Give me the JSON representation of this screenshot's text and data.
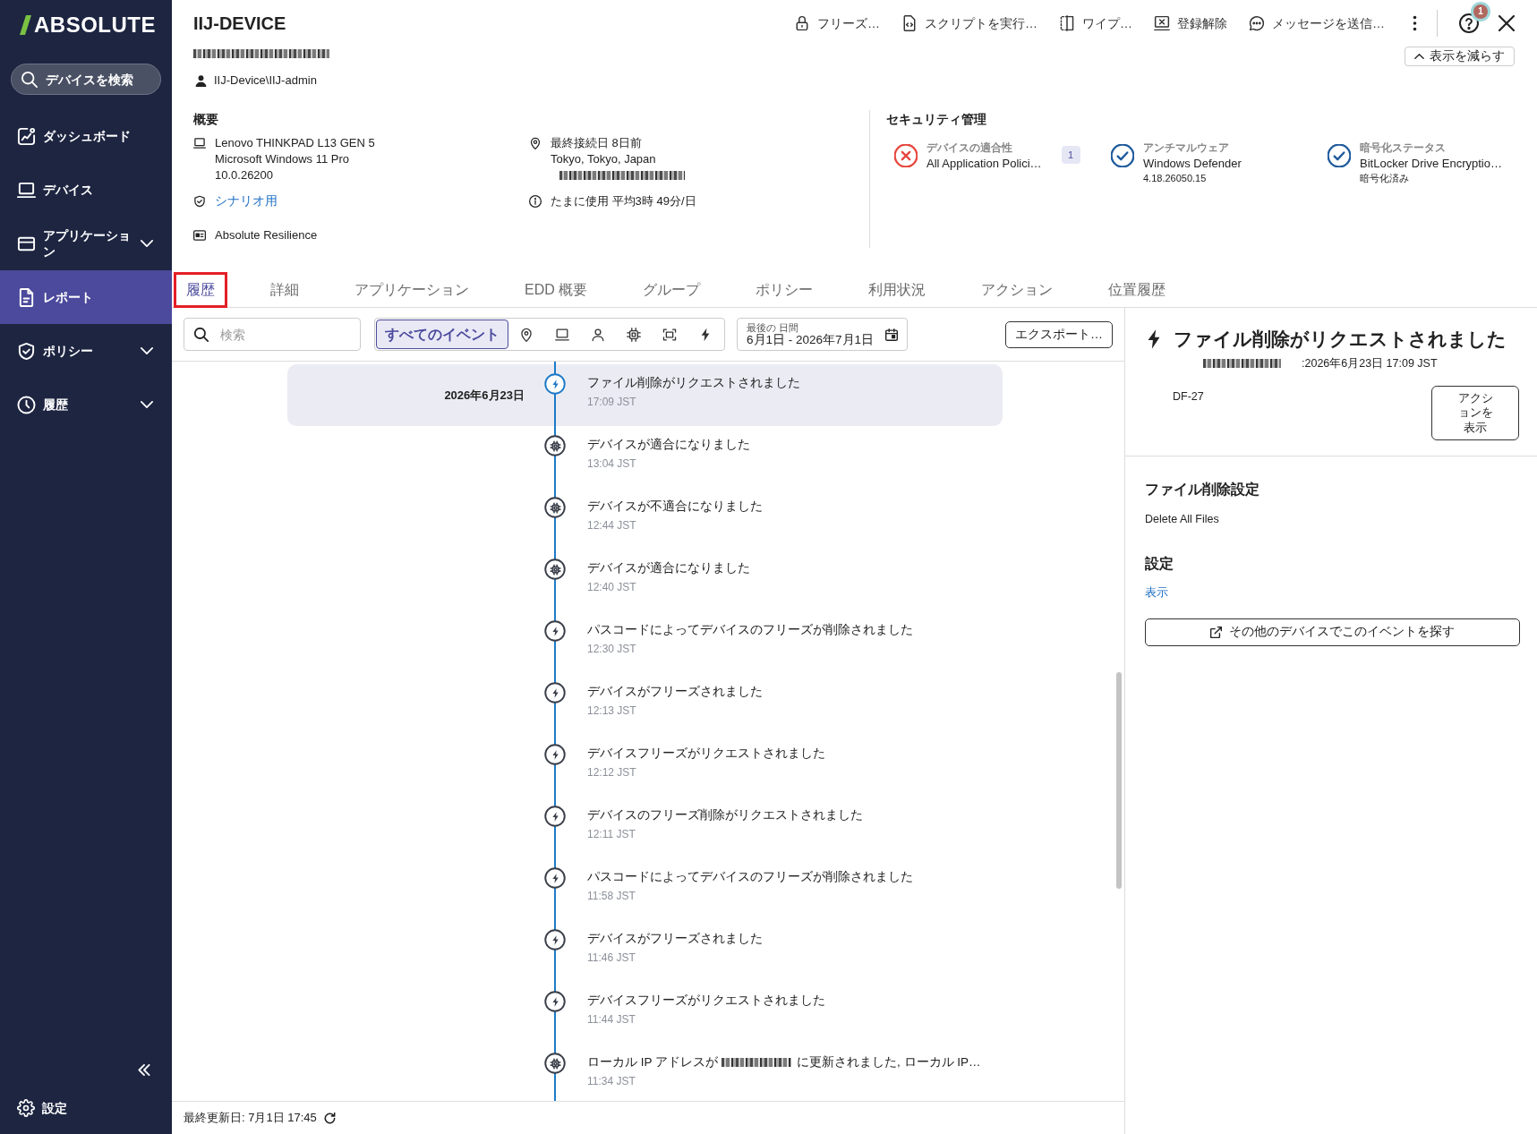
{
  "sidebar": {
    "logo": "ABSOLUTE",
    "search": {
      "placeholder": "デバイスを検索"
    },
    "items": [
      {
        "label": "ダッシュボード",
        "selected": false,
        "expandable": false
      },
      {
        "label": "デバイス",
        "selected": false,
        "expandable": false
      },
      {
        "label": "アプリケーション",
        "selected": false,
        "expandable": true
      },
      {
        "label": "レポート",
        "selected": true,
        "expandable": false
      },
      {
        "label": "ポリシー",
        "selected": false,
        "expandable": true
      },
      {
        "label": "履歴",
        "selected": false,
        "expandable": true
      }
    ],
    "settings": "設定"
  },
  "device": {
    "name": "IIJ-DEVICE",
    "serial_redacted": true,
    "user": "IIJ-Device\\IIJ-admin"
  },
  "actions": [
    {
      "label": "フリーズ…"
    },
    {
      "label": "スクリプトを実行…"
    },
    {
      "label": "ワイプ…"
    },
    {
      "label": "登録解除"
    },
    {
      "label": "メッセージを送信…"
    }
  ],
  "help": {
    "badge": "1"
  },
  "collapse_button": "表示を減らす",
  "overview": {
    "heading": "概要",
    "hardware": [
      "Lenovo THINKPAD L13 GEN 5",
      "Microsoft Windows 11 Pro",
      "10.0.26200"
    ],
    "policy_link": "シナリオ用",
    "license": "Absolute Resilience",
    "location": [
      "最終接続日 8日前",
      "Tokyo, Tokyo, Japan"
    ],
    "ip_redacted": true,
    "usage": "たまに使用 平均3時 49分/日"
  },
  "security": {
    "heading": "セキュリティ管理",
    "items": [
      {
        "label": "デバイスの適合性",
        "value": "All Application Polici…",
        "passed": false,
        "count": "1"
      },
      {
        "label": "アンチマルウェア",
        "value": "Windows Defender",
        "detail": "4.18.26050.15",
        "passed": true
      },
      {
        "label": "暗号化ステータス",
        "value": "BitLocker Drive Encryptio…",
        "detail": "暗号化済み",
        "passed": true
      }
    ]
  },
  "tabs": [
    {
      "label": "履歴",
      "selected": true,
      "highlighted": true
    },
    {
      "label": "詳細",
      "selected": false,
      "highlighted": false
    },
    {
      "label": "アプリケーション",
      "selected": false,
      "highlighted": false
    },
    {
      "label": "EDD 概要",
      "selected": false,
      "highlighted": false
    },
    {
      "label": "グループ",
      "selected": false,
      "highlighted": false
    },
    {
      "label": "ポリシー",
      "selected": false,
      "highlighted": false
    },
    {
      "label": "利用状況",
      "selected": false,
      "highlighted": false
    },
    {
      "label": "アクション",
      "selected": false,
      "highlighted": false
    },
    {
      "label": "位置履歴",
      "selected": false,
      "highlighted": false
    }
  ],
  "toolbar": {
    "search": {
      "placeholder": "検索"
    },
    "filters": [
      {
        "kind": "text",
        "label": "すべてのイベント",
        "selected": true
      },
      {
        "kind": "icon",
        "selected": false
      },
      {
        "kind": "icon",
        "selected": false
      },
      {
        "kind": "icon",
        "selected": false
      },
      {
        "kind": "icon",
        "selected": false
      },
      {
        "kind": "icon",
        "selected": false
      },
      {
        "kind": "icon",
        "selected": false
      }
    ],
    "date_range": {
      "caption": "最後の 日間",
      "value": "6月1日 - 2026年7月1日"
    },
    "export": "エクスポート…"
  },
  "timeline": {
    "date": "2026年6月23日",
    "events": [
      {
        "kind": "action",
        "title": "ファイル削除がリクエストされました",
        "time": "17:09 JST",
        "selected": true
      },
      {
        "kind": "system",
        "title": "デバイスが適合になりました",
        "time": "13:04 JST",
        "selected": false
      },
      {
        "kind": "system",
        "title": "デバイスが不適合になりました",
        "time": "12:44 JST",
        "selected": false
      },
      {
        "kind": "system",
        "title": "デバイスが適合になりました",
        "time": "12:40 JST",
        "selected": false
      },
      {
        "kind": "action",
        "title": "パスコードによってデバイスのフリーズが削除されました",
        "time": "12:30 JST",
        "selected": false
      },
      {
        "kind": "action",
        "title": "デバイスがフリーズされました",
        "time": "12:13 JST",
        "selected": false
      },
      {
        "kind": "action",
        "title": "デバイスフリーズがリクエストされました",
        "time": "12:12 JST",
        "selected": false
      },
      {
        "kind": "action",
        "title": "デバイスのフリーズ削除がリクエストされました",
        "time": "12:11 JST",
        "selected": false
      },
      {
        "kind": "action",
        "title": "パスコードによってデバイスのフリーズが削除されました",
        "time": "11:58 JST",
        "selected": false
      },
      {
        "kind": "action",
        "title": "デバイスがフリーズされました",
        "time": "11:46 JST",
        "selected": false
      },
      {
        "kind": "action",
        "title": "デバイスフリーズがリクエストされました",
        "time": "11:44 JST",
        "selected": false
      },
      {
        "kind": "system",
        "title": "ローカル IP アドレスが",
        "redacted": true,
        "title_after": "に更新されました, ローカル IP…",
        "time": "11:34 JST",
        "selected": false
      }
    ]
  },
  "footer": {
    "last_updated": "最終更新日: 7月1日 17:45"
  },
  "detail": {
    "title": "ファイル削除がリクエストされました",
    "user_redacted": true,
    "timestamp": ":2026年6月23日 17:09 JST",
    "code": "DF-27",
    "action_button": "アクションを表示",
    "settings_heading": "ファイル削除設定",
    "settings_value": "Delete All Files",
    "section_heading": "設定",
    "section_link": "表示",
    "find_button": "その他のデバイスでこのイベントを探す"
  }
}
